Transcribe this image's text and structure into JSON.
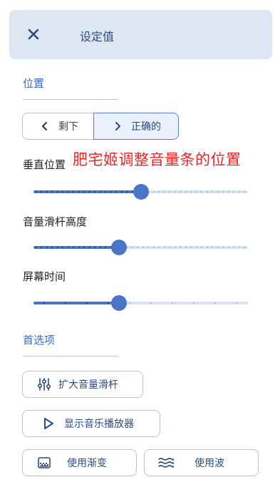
{
  "header": {
    "title": "设定值",
    "close_icon": "close-icon"
  },
  "position_section": {
    "title": "位置",
    "segments": [
      {
        "label": "剩下",
        "icon": "chevron-left-icon",
        "selected": false
      },
      {
        "label": "正确的",
        "icon": "chevron-right-icon",
        "selected": true
      }
    ]
  },
  "annotation": "肥宅姬调整音量条的位置",
  "sliders": [
    {
      "label": "垂直位置",
      "value": 0.5,
      "style": "dense-ticks"
    },
    {
      "label": "音量滑杆高度",
      "value": 0.4,
      "style": "dense-ticks"
    },
    {
      "label": "屏幕时间",
      "value": 0.4,
      "style": "sparse-ticks"
    }
  ],
  "preferences": {
    "title": "首选项",
    "buttons": [
      {
        "label": "扩大音量滑杆",
        "icon": "sliders-icon"
      },
      {
        "label": "显示音乐播放器",
        "icon": "play-icon"
      },
      {
        "label": "使用渐变",
        "icon": "gradient-icon"
      },
      {
        "label": "使用波",
        "icon": "wave-icon"
      }
    ]
  },
  "colors": {
    "accent": "#4a76c8",
    "header_bg": "#dde6f3",
    "annotation": "#ee2424"
  }
}
